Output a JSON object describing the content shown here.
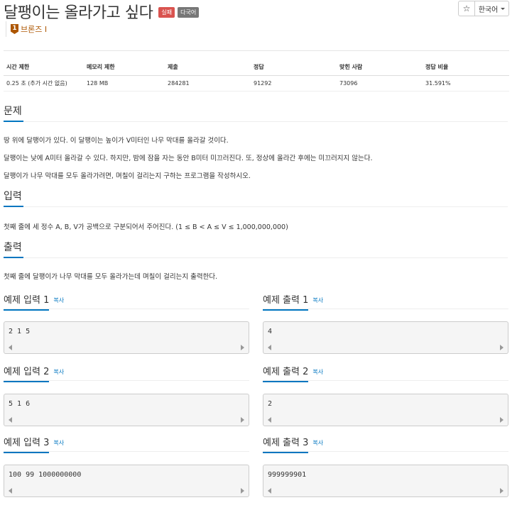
{
  "problem": {
    "title": "달팽이는 올라가고 싶다",
    "labels": [
      "실패",
      "다국어"
    ],
    "tier": {
      "number": "1",
      "name": "브론즈 I"
    }
  },
  "toolbar": {
    "star_glyph": "☆",
    "language": "한국어"
  },
  "info_table": {
    "headers": [
      "시간 제한",
      "메모리 제한",
      "제출",
      "정답",
      "맞힌 사람",
      "정답 비율"
    ],
    "values": [
      "0.25 초 (추가 시간 없음)",
      "128 MB",
      "284281",
      "91292",
      "73096",
      "31.591%"
    ]
  },
  "sections": {
    "problem": {
      "title": "문제",
      "paragraphs": [
        "땅 위에 달팽이가 있다. 이 달팽이는 높이가 V미터인 나무 막대를 올라갈 것이다.",
        "달팽이는 낮에 A미터 올라갈 수 있다. 하지만, 밤에 잠을 자는 동안 B미터 미끄러진다. 또, 정상에 올라간 후에는 미끄러지지 않는다.",
        "달팽이가 나무 막대를 모두 올라가려면, 며칠이 걸리는지 구하는 프로그램을 작성하시오."
      ]
    },
    "input": {
      "title": "입력",
      "text": "첫째 줄에 세 정수 A, B, V가 공백으로 구분되어서 주어진다. (1 ≤ B < A ≤ V ≤ 1,000,000,000)"
    },
    "output": {
      "title": "출력",
      "text": "첫째 줄에 달팽이가 나무 막대를 모두 올라가는데 며칠이 걸리는지 출력한다."
    }
  },
  "samples": {
    "copy_label": "복사",
    "items": [
      {
        "input_title": "예제 입력 1",
        "input": "2 1 5",
        "output_title": "예제 출력 1",
        "output": "4"
      },
      {
        "input_title": "예제 입력 2",
        "input": "5 1 6",
        "output_title": "예제 출력 2",
        "output": "2"
      },
      {
        "input_title": "예제 입력 3",
        "input": "100 99 1000000000",
        "output_title": "예제 출력 3",
        "output": "999999901"
      }
    ]
  },
  "colors": {
    "accent": "#0076c0",
    "tier_bronze": "#ad5600",
    "label_fail": "#d9534f",
    "label_multi": "#777777"
  }
}
